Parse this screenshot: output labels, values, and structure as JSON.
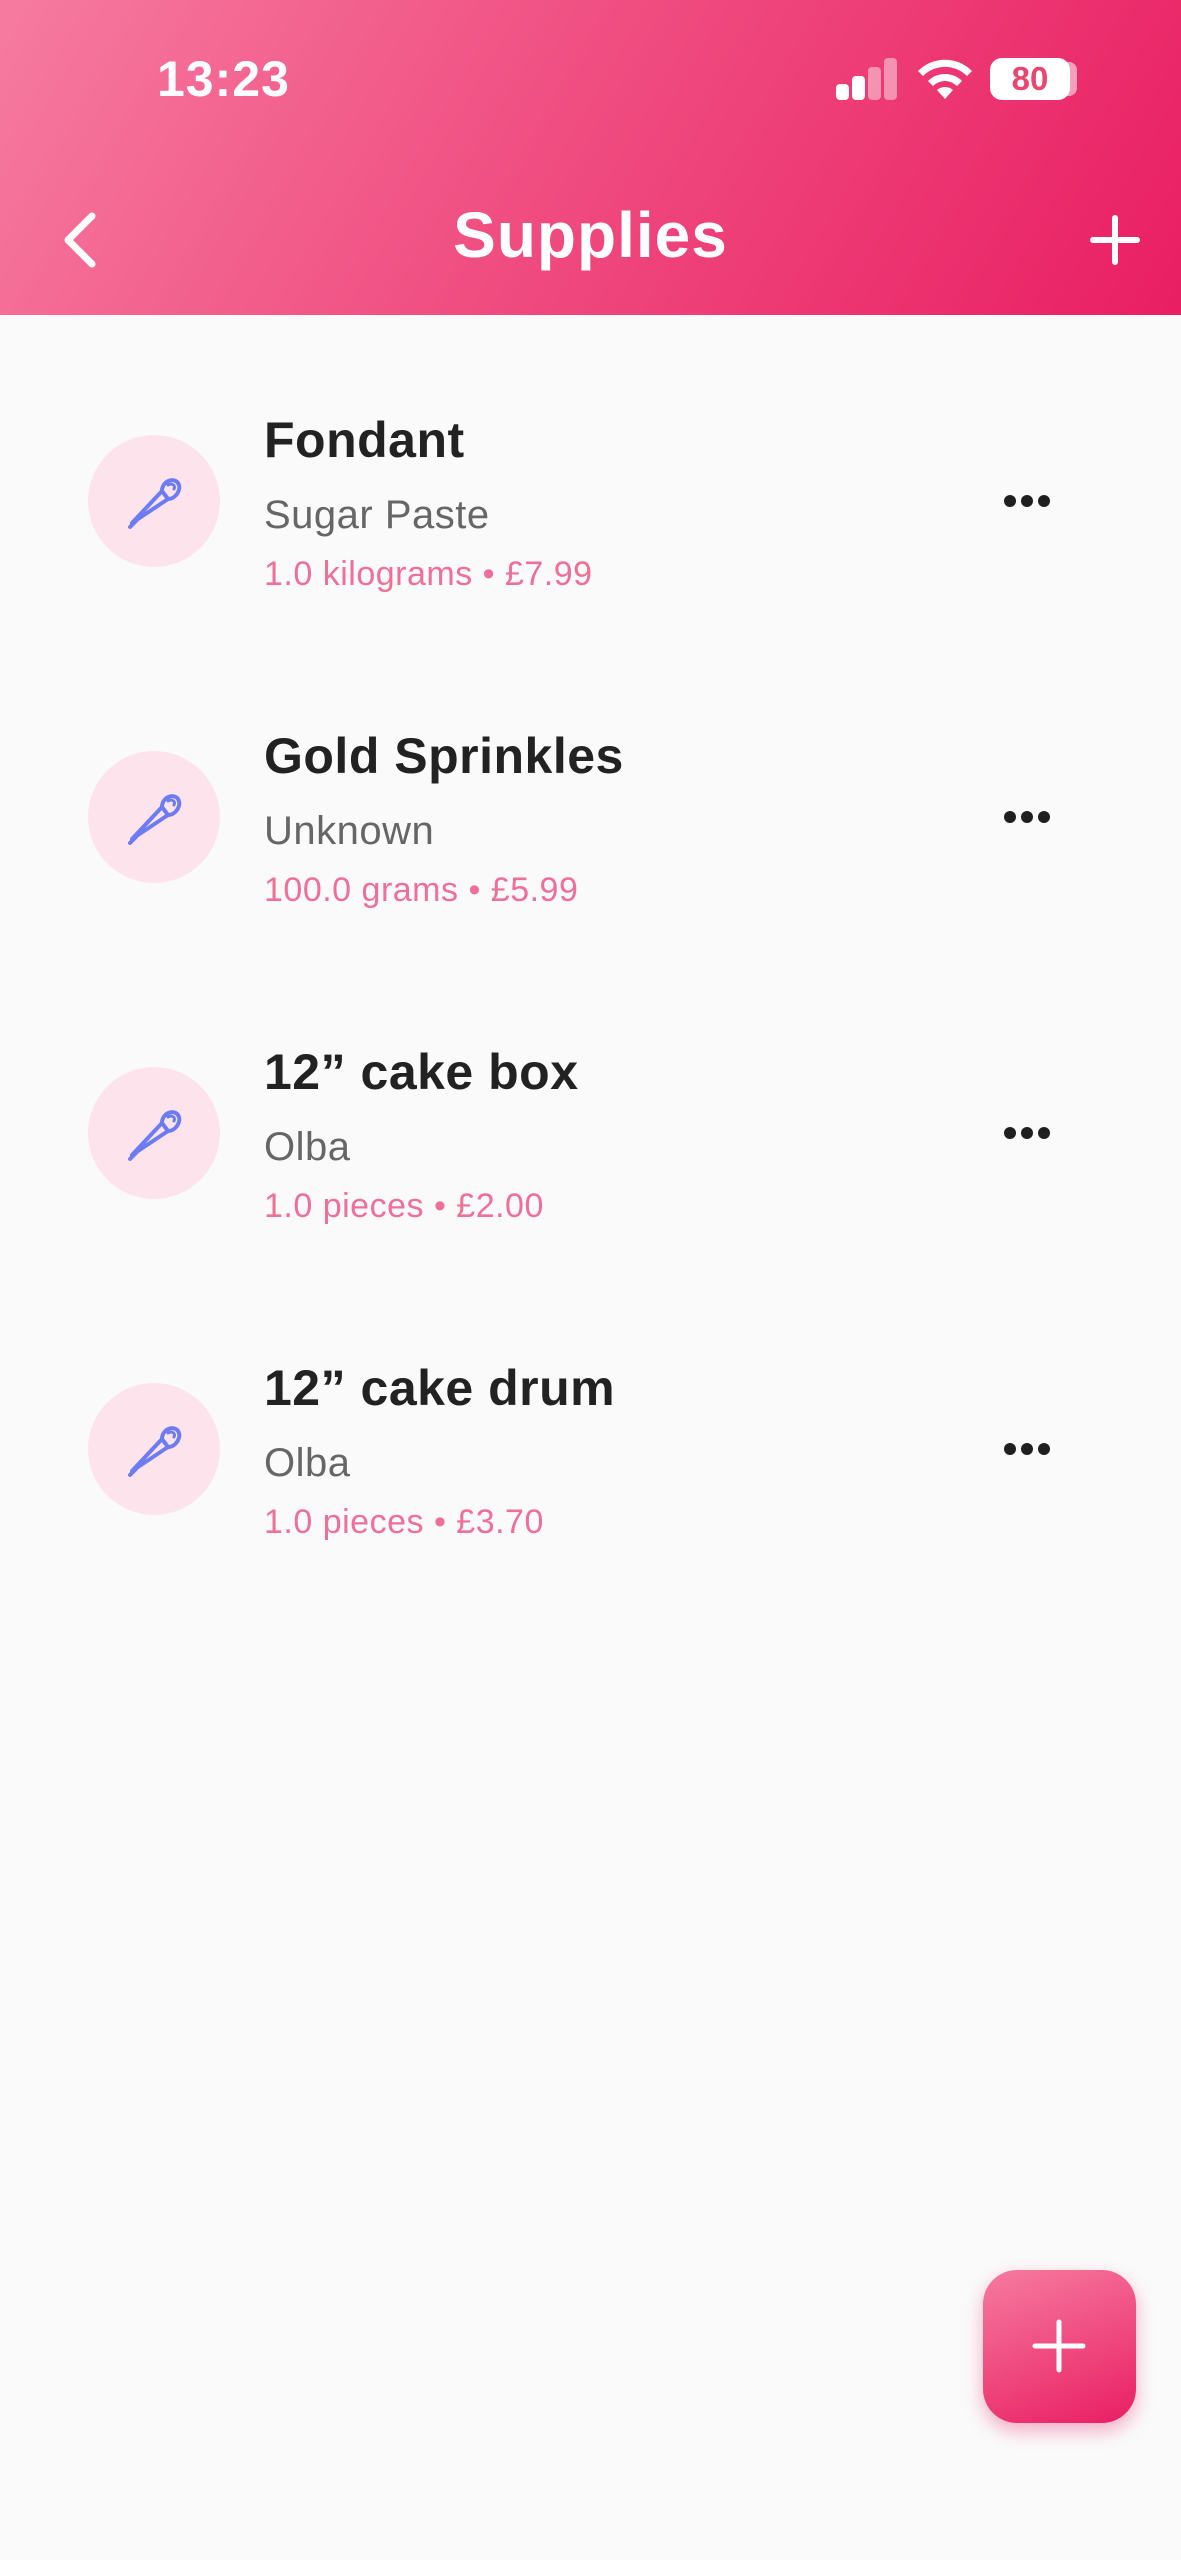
{
  "status_bar": {
    "time": "13:23",
    "battery": "80",
    "icons": [
      "signal-icon",
      "wifi-icon",
      "battery-icon"
    ]
  },
  "header": {
    "title": "Supplies",
    "back_icon": "chevron-left-icon",
    "add_icon": "plus-icon"
  },
  "supplies": [
    {
      "name": "Fondant",
      "brand": "Sugar Paste",
      "meta": "1.0 kilograms • £7.99"
    },
    {
      "name": "Gold Sprinkles",
      "brand": "Unknown",
      "meta": "100.0 grams • £5.99"
    },
    {
      "name": "12” cake box",
      "brand": "Olba",
      "meta": "1.0 pieces • £2.00"
    },
    {
      "name": "12” cake drum",
      "brand": "Olba",
      "meta": "1.0 pieces • £3.70"
    }
  ],
  "item_icon": "piping-bag-icon",
  "item_menu_icon": "more-horizontal-icon",
  "fab_icon": "plus-icon",
  "colors": {
    "accent": "#e91e63",
    "accent_light": "#f67ba0",
    "meta_text": "#ee6f97",
    "avatar_bg": "#fde4ec",
    "icon_blue": "#6d7cf2"
  }
}
